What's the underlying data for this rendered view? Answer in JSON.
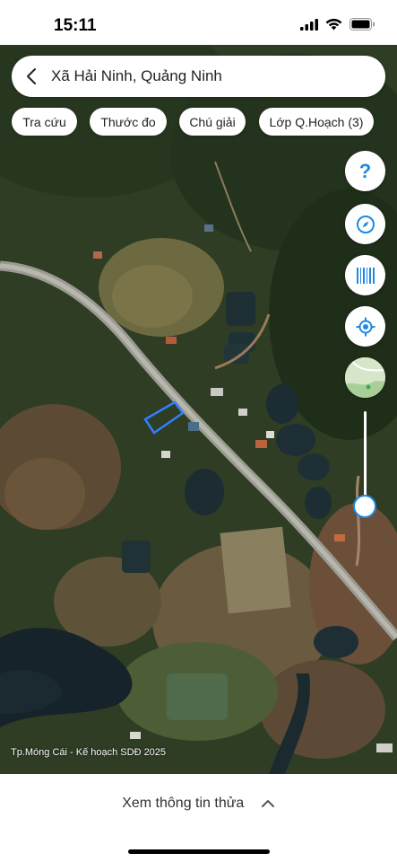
{
  "status_bar": {
    "time": "15:11"
  },
  "search": {
    "location": "Xã Hải Ninh, Quảng Ninh"
  },
  "chips": [
    {
      "label": "Tra cứu"
    },
    {
      "label": "Thước đo"
    },
    {
      "label": "Chú giải"
    },
    {
      "label": "Lớp Q.Hoạch (3)"
    }
  ],
  "side_controls": {
    "help_label": "?"
  },
  "opacity_slider": {
    "value": 0.9
  },
  "map": {
    "watermark": "Tp.Móng Cái - Kế hoạch SDĐ 2025"
  },
  "bottom": {
    "label": "Xem thông tin thửa"
  },
  "colors": {
    "accent": "#1e88e5"
  },
  "icons": [
    "wifi-icon",
    "signal-icon",
    "battery-icon",
    "back-chevron-icon",
    "help-icon",
    "compass-icon",
    "barcode-icon",
    "locate-icon",
    "layer-thumbnail-icon",
    "chevron-up-icon"
  ]
}
